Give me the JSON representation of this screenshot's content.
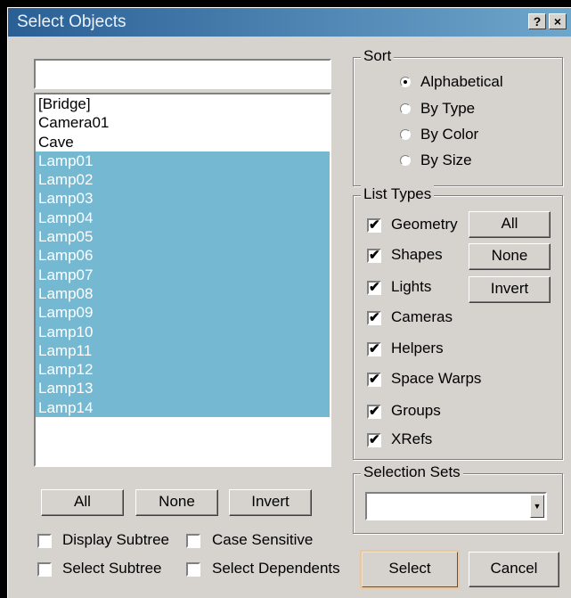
{
  "window": {
    "title": "Select Objects",
    "help_label": "?",
    "close_label": "×"
  },
  "filter": {
    "value": ""
  },
  "objects": [
    {
      "label": "[Bridge]",
      "selected": false
    },
    {
      "label": "Camera01",
      "selected": false
    },
    {
      "label": "Cave",
      "selected": false
    },
    {
      "label": "Lamp01",
      "selected": true
    },
    {
      "label": "Lamp02",
      "selected": true
    },
    {
      "label": "Lamp03",
      "selected": true
    },
    {
      "label": "Lamp04",
      "selected": true
    },
    {
      "label": "Lamp05",
      "selected": true
    },
    {
      "label": "Lamp06",
      "selected": true
    },
    {
      "label": "Lamp07",
      "selected": true
    },
    {
      "label": "Lamp08",
      "selected": true
    },
    {
      "label": "Lamp09",
      "selected": true
    },
    {
      "label": "Lamp10",
      "selected": true
    },
    {
      "label": "Lamp11",
      "selected": true
    },
    {
      "label": "Lamp12",
      "selected": true
    },
    {
      "label": "Lamp13",
      "selected": true
    },
    {
      "label": "Lamp14",
      "selected": true
    }
  ],
  "list_buttons": {
    "all": "All",
    "none": "None",
    "invert": "Invert"
  },
  "options": {
    "display_subtree": {
      "label": "Display Subtree",
      "checked": false
    },
    "case_sensitive": {
      "label": "Case Sensitive",
      "checked": false
    },
    "select_subtree": {
      "label": "Select Subtree",
      "checked": false
    },
    "select_dependents": {
      "label": "Select Dependents",
      "checked": false
    }
  },
  "sort": {
    "label": "Sort",
    "alphabetical": "Alphabetical",
    "by_type": "By Type",
    "by_color": "By Color",
    "by_size": "By Size",
    "selected": "Alphabetical"
  },
  "list_types": {
    "label": "List Types",
    "geometry": "Geometry",
    "shapes": "Shapes",
    "lights": "Lights",
    "cameras": "Cameras",
    "helpers": "Helpers",
    "space_warps": "Space Warps",
    "groups": "Groups",
    "xrefs": "XRefs",
    "checked_mark": "✔",
    "all": "All",
    "none": "None",
    "invert": "Invert"
  },
  "selection_sets": {
    "label": "Selection Sets",
    "value": "",
    "arrow": "▼"
  },
  "actions": {
    "select": "Select",
    "cancel": "Cancel"
  },
  "colors": {
    "selection": "#74b8d2",
    "title_start": "#2a5f95",
    "title_end": "#6ea6cc",
    "face": "#d6d3ce"
  }
}
